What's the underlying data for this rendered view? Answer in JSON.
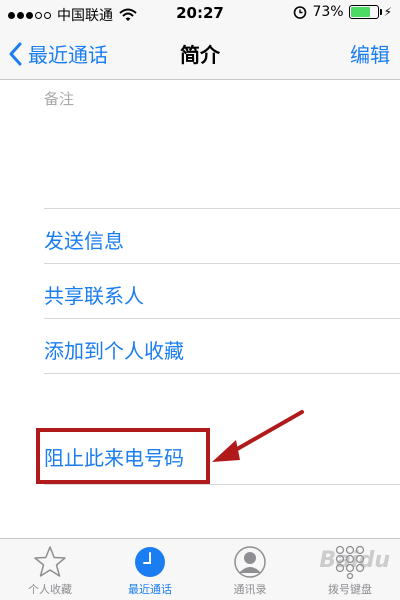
{
  "status_bar": {
    "carrier": "中国联通",
    "time": "20:27",
    "battery_percent": "73%",
    "battery_level": 0.73,
    "icons": [
      "signal-dots",
      "wifi-icon",
      "alarm-icon",
      "battery-icon"
    ]
  },
  "nav": {
    "back_label": "最近通话",
    "title": "简介",
    "edit_label": "编辑"
  },
  "notes": {
    "label": "备注"
  },
  "actions": [
    {
      "label": "发送信息"
    },
    {
      "label": "共享联系人"
    },
    {
      "label": "添加到个人收藏"
    }
  ],
  "block_action": {
    "label": "阻止此来电号码"
  },
  "tabs": [
    {
      "label": "个人收藏",
      "icon": "star-icon",
      "active": false
    },
    {
      "label": "最近通话",
      "icon": "clock-icon",
      "active": true
    },
    {
      "label": "通讯录",
      "icon": "contacts-icon",
      "active": false
    },
    {
      "label": "拨号键盘",
      "icon": "keypad-icon",
      "active": false
    }
  ],
  "colors": {
    "accent": "#1a7df2",
    "highlight": "#b01a1a",
    "battery": "#4cd964"
  },
  "watermark": "Baidu"
}
